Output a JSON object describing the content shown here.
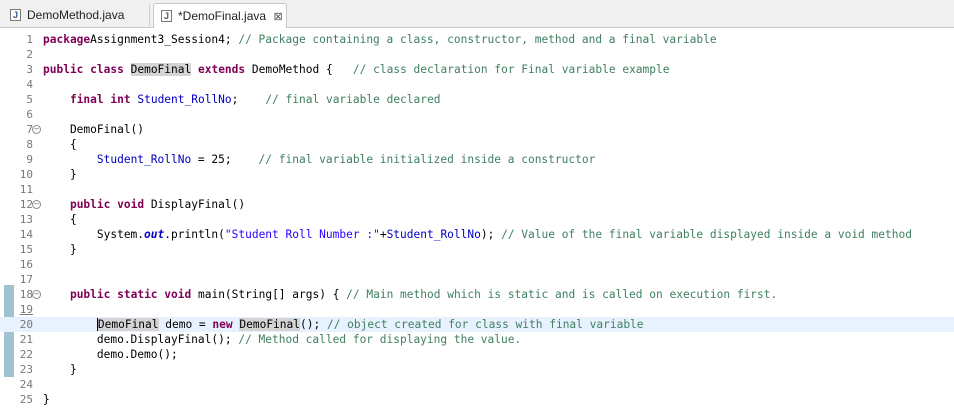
{
  "tabs": [
    {
      "label": "DemoMethod.java",
      "active": false
    },
    {
      "label": "*DemoFinal.java",
      "active": true
    }
  ],
  "icons": {
    "java_file": "java-file-icon",
    "close": "close-icon",
    "fold": "fold-collapse-icon"
  },
  "colors": {
    "keyword": "#7f0055",
    "comment": "#3f7f5f",
    "field": "#0000c0",
    "string": "#2a00ff",
    "current_line": "#e8f2fe"
  },
  "editor": {
    "current_line": 20,
    "lines": [
      {
        "n": "1",
        "tokens": [
          [
            "kw",
            "package"
          ],
          [
            "",
            "Assignment3_Session4; "
          ],
          [
            "cm",
            "// Package containing a class, constructor, method and a final variable"
          ]
        ]
      },
      {
        "n": "2",
        "tokens": []
      },
      {
        "n": "3",
        "tokens": [
          [
            "kw",
            "public"
          ],
          [
            "",
            " "
          ],
          [
            "kw",
            "class"
          ],
          [
            "",
            " "
          ],
          [
            "hl",
            "DemoFinal"
          ],
          [
            "",
            " "
          ],
          [
            "kw",
            "extends"
          ],
          [
            "",
            " DemoMethod {   "
          ],
          [
            "cm",
            "// class declaration for Final variable example"
          ]
        ]
      },
      {
        "n": "4",
        "tokens": []
      },
      {
        "n": "5",
        "tokens": [
          [
            "",
            "    "
          ],
          [
            "kw",
            "final"
          ],
          [
            "",
            " "
          ],
          [
            "kw",
            "int"
          ],
          [
            "",
            " "
          ],
          [
            "fd",
            "Student_RollNo"
          ],
          [
            "",
            ";    "
          ],
          [
            "cm",
            "// final variable declared"
          ]
        ]
      },
      {
        "n": "6",
        "tokens": []
      },
      {
        "n": "7",
        "fold": true,
        "tokens": [
          [
            "",
            "    DemoFinal()"
          ]
        ]
      },
      {
        "n": "8",
        "tokens": [
          [
            "",
            "    {"
          ]
        ]
      },
      {
        "n": "9",
        "tokens": [
          [
            "",
            "        "
          ],
          [
            "fd",
            "Student_RollNo"
          ],
          [
            "",
            " = 25;    "
          ],
          [
            "cm",
            "// final variable initialized inside a constructor"
          ]
        ]
      },
      {
        "n": "10",
        "tokens": [
          [
            "",
            "    }"
          ]
        ]
      },
      {
        "n": "11",
        "tokens": []
      },
      {
        "n": "12",
        "fold": true,
        "tokens": [
          [
            "",
            "    "
          ],
          [
            "kw",
            "public"
          ],
          [
            "",
            " "
          ],
          [
            "kw",
            "void"
          ],
          [
            "",
            " DisplayFinal()"
          ]
        ]
      },
      {
        "n": "13",
        "tokens": [
          [
            "",
            "    {"
          ]
        ]
      },
      {
        "n": "14",
        "tokens": [
          [
            "",
            "        System."
          ],
          [
            "sm",
            "out"
          ],
          [
            "",
            ".println("
          ],
          [
            "st",
            "\"Student Roll Number :\""
          ],
          [
            "",
            "+"
          ],
          [
            "fd",
            "Student_RollNo"
          ],
          [
            "",
            "); "
          ],
          [
            "cm",
            "// Value of the final variable displayed inside a void method"
          ]
        ]
      },
      {
        "n": "15",
        "tokens": [
          [
            "",
            "    }"
          ]
        ]
      },
      {
        "n": "16",
        "tokens": []
      },
      {
        "n": "17",
        "tokens": []
      },
      {
        "n": "18",
        "fold": true,
        "tokens": [
          [
            "",
            "    "
          ],
          [
            "kw",
            "public"
          ],
          [
            "",
            " "
          ],
          [
            "kw",
            "static"
          ],
          [
            "",
            " "
          ],
          [
            "kw",
            "void"
          ],
          [
            "",
            " main(String[] args) { "
          ],
          [
            "cm",
            "// Main method which is static and is called on execution first."
          ]
        ]
      },
      {
        "n": "19",
        "underline": true,
        "tokens": []
      },
      {
        "n": "20",
        "tokens": [
          [
            "",
            "        "
          ],
          [
            "hlc",
            "DemoFinal"
          ],
          [
            "",
            " demo = "
          ],
          [
            "kw",
            "new"
          ],
          [
            "",
            " "
          ],
          [
            "hl",
            "DemoFinal"
          ],
          [
            "",
            "(); "
          ],
          [
            "cm",
            "// object created for class with final variable"
          ]
        ]
      },
      {
        "n": "21",
        "tokens": [
          [
            "",
            "        demo.DisplayFinal(); "
          ],
          [
            "cm",
            "// Method called for displaying the value."
          ]
        ]
      },
      {
        "n": "22",
        "tokens": [
          [
            "",
            "        demo.Demo();"
          ]
        ]
      },
      {
        "n": "23",
        "tokens": [
          [
            "",
            "    }"
          ]
        ]
      },
      {
        "n": "24",
        "tokens": []
      },
      {
        "n": "25",
        "tokens": [
          [
            "",
            "}"
          ]
        ]
      }
    ]
  }
}
